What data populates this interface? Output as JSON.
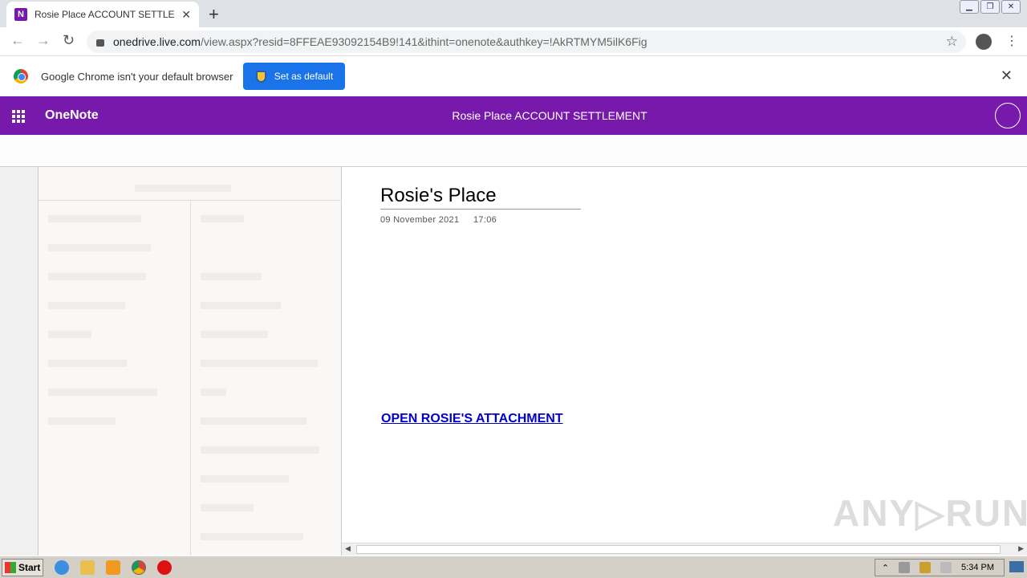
{
  "browser": {
    "tab_title": "Rosie Place ACCOUNT SETTLEMENT",
    "tab_favicon": "N",
    "url_host": "onedrive.live.com",
    "url_path": "/view.aspx?resid=8FFEAE93092154B9!141&ithint=onenote&authkey=!AkRTMYM5ilK6Fig",
    "infobar_message": "Google Chrome isn't your default browser",
    "set_default_label": "Set as default"
  },
  "app": {
    "name": "OneNote",
    "document_title": "Rosie Place ACCOUNT SETTLEMENT",
    "header_color": "#7719aa"
  },
  "page": {
    "title": "Rosie's Place",
    "date": "09 November 2021",
    "time": "17:06",
    "link_text": "OPEN ROSIE'S ATTACHMENT",
    "link_color": "#0000cc"
  },
  "watermark": "ANY RUN",
  "taskbar": {
    "start_label": "Start",
    "clock": "5:34 PM"
  }
}
